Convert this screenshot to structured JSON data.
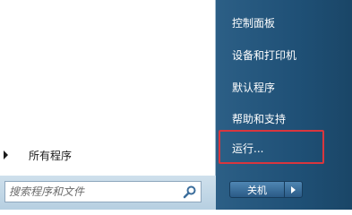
{
  "left_pane": {
    "all_programs_label": "所有程序"
  },
  "search": {
    "placeholder": "搜索程序和文件"
  },
  "right_pane": {
    "items": [
      {
        "label": "控制面板"
      },
      {
        "label": "设备和打印机"
      },
      {
        "label": "默认程序"
      },
      {
        "label": "帮助和支持"
      },
      {
        "label": "运行..."
      }
    ]
  },
  "shutdown": {
    "label": "关机"
  },
  "icons": {
    "search": "search-icon",
    "all_programs_arrow": "arrow-right-icon",
    "shutdown_options": "arrow-right-icon"
  },
  "colors": {
    "right_pane": "#1f5076",
    "highlight": "#d9363e"
  }
}
